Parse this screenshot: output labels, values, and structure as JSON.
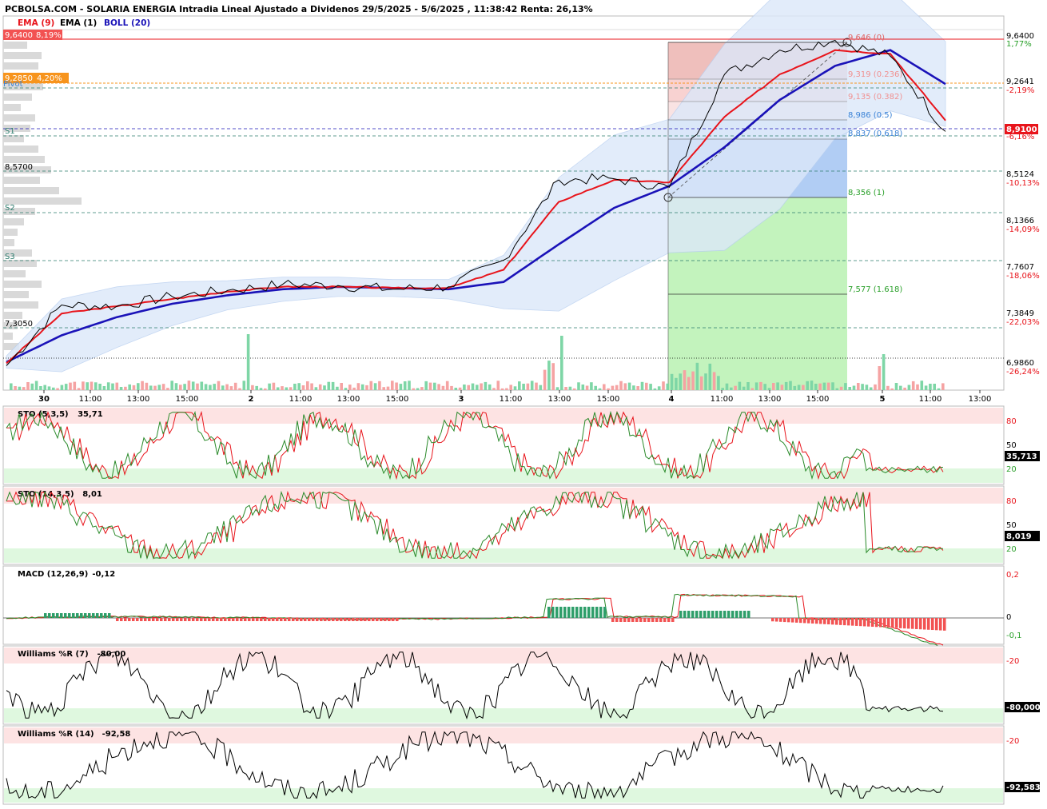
{
  "header": {
    "title": "PCBOLSA.COM - SOLARIA ENERGIA Intradia Lineal Ajustado a Dividenos 29/5/2025 - 5/6/2025 , 11:38:42 Renta: 26,13%",
    "legend": [
      {
        "label": "EMA (9)",
        "color": "#e8141b"
      },
      {
        "label": "EMA (1)",
        "color": "#000000"
      },
      {
        "label": "BOLL (20)",
        "color": "#1a12b8"
      }
    ]
  },
  "colors": {
    "price": "#000000",
    "ema9": "#e8141b",
    "boll_mid": "#1a12b8",
    "boll_band": "#dce8fa",
    "up": "#2e9e6a",
    "down": "#f25252",
    "zone_high": "#fde3e3",
    "zone_low": "#dff8df",
    "grid": "#2e7d6e"
  },
  "main": {
    "right_axis": [
      "9,6400",
      "9,2641",
      "8,8882",
      "8,5124",
      "8,1366",
      "7,7607",
      "7,3849",
      "6,9860"
    ],
    "right_axis_pct": [
      "1,77%",
      "-2,19%",
      "-6,16%",
      "-10,13%",
      "-14,09%",
      "-18,06%",
      "-22,03%",
      "-26,24%"
    ],
    "last_price": "8,9100",
    "left_badges": [
      {
        "value": "9,6400",
        "pct": "8,19%",
        "color": "#f25252"
      },
      {
        "value": "9,2850",
        "pct": "4,20%",
        "color": "#f7941d"
      }
    ],
    "left_levels": [
      "8,5700",
      "7,3050"
    ],
    "pivots": [
      "Pivot",
      "S1",
      "S2",
      "S3"
    ],
    "fibonacci": [
      {
        "label": "9,646 (0)",
        "color": "#e06060"
      },
      {
        "label": "9,319 (0.236)",
        "color": "#f09090"
      },
      {
        "label": "9,135 (0.382)",
        "color": "#f09090"
      },
      {
        "label": "8,986 (0.5)",
        "color": "#3a82d6"
      },
      {
        "label": "8,837 (0.618)",
        "color": "#3a82d6"
      },
      {
        "label": "8,356 (1)",
        "color": "#2aa02a"
      },
      {
        "label": "7,577 (1.618)",
        "color": "#2aa02a"
      }
    ]
  },
  "x_axis": [
    "30",
    "11:00",
    "13:00",
    "15:00",
    "2",
    "11:00",
    "13:00",
    "15:00",
    "3",
    "11:00",
    "13:00",
    "15:00",
    "4",
    "11:00",
    "13:00",
    "15:00",
    "5",
    "11:00",
    "13:00"
  ],
  "panels": [
    {
      "name": "STO (5,3,5)",
      "value": "35,71",
      "last": "35,713",
      "levels": [
        "80",
        "50",
        "20"
      ]
    },
    {
      "name": "STO (14,3,5)",
      "value": "8,01",
      "last": "8,019",
      "levels": [
        "80",
        "50",
        "20"
      ]
    },
    {
      "name": "MACD (12,26,9)",
      "value": "-0,12",
      "last": "",
      "levels": [
        "0,2",
        "0",
        "-0,1"
      ]
    },
    {
      "name": "Williams %R (7)",
      "value": "-80,00",
      "last": "-80,000",
      "levels": [
        "-20",
        "",
        "-80"
      ]
    },
    {
      "name": "Williams %R (14)",
      "value": "-92,58",
      "last": "-92,583",
      "levels": [
        "-20",
        "",
        "-80"
      ]
    }
  ],
  "chart_data": {
    "type": "line",
    "title": "PCBOLSA.COM - SOLARIA ENERGIA Intradia Lineal Ajustado a Dividenos 29/5/2025 - 5/6/2025 , 11:38:42 Renta: 26,13%",
    "ylim": [
      6.986,
      9.64
    ],
    "x": [
      "30",
      "30 11:00",
      "30 13:00",
      "30 15:00",
      "2",
      "2 11:00",
      "2 13:00",
      "2 15:00",
      "3",
      "3 11:00",
      "3 13:00",
      "3 15:00",
      "4",
      "4 11:00",
      "4 13:00",
      "4 15:00",
      "5",
      "5 11:00"
    ],
    "series": [
      {
        "name": "EMA (1)",
        "values": [
          6.95,
          7.45,
          7.44,
          7.52,
          7.57,
          7.62,
          7.61,
          7.58,
          7.6,
          7.82,
          8.48,
          8.49,
          8.42,
          9.35,
          9.55,
          9.63,
          9.5,
          8.88
        ]
      },
      {
        "name": "EMA (9)",
        "values": [
          6.97,
          7.38,
          7.44,
          7.5,
          7.56,
          7.6,
          7.6,
          7.59,
          7.59,
          7.74,
          8.3,
          8.48,
          8.46,
          9.0,
          9.35,
          9.55,
          9.52,
          8.97
        ]
      },
      {
        "name": "BOLL (20)",
        "values": [
          6.98,
          7.2,
          7.35,
          7.46,
          7.53,
          7.58,
          7.6,
          7.59,
          7.58,
          7.64,
          7.95,
          8.25,
          8.43,
          8.75,
          9.14,
          9.42,
          9.55,
          9.27
        ]
      }
    ],
    "fibonacci": [
      9.646,
      9.319,
      9.135,
      8.986,
      8.837,
      8.356,
      7.577
    ]
  }
}
